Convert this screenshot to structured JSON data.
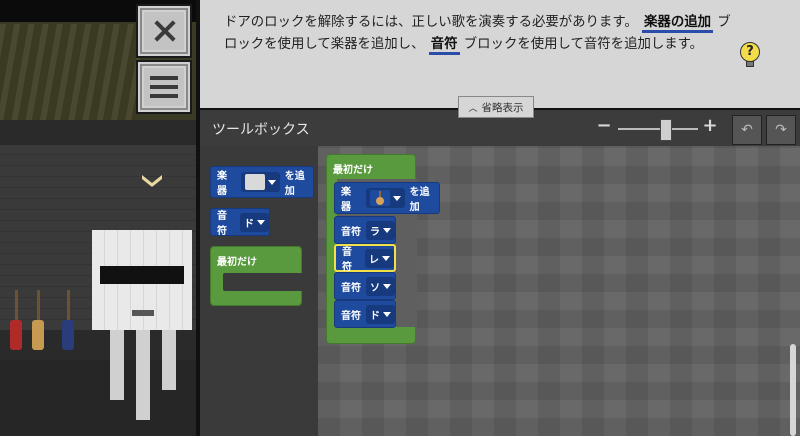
{
  "instruction": {
    "part1": "ドアのロックを解除するには、正しい歌を演奏する必要があります。",
    "kw1": "楽器の追加",
    "part2": "ブロックを使用して楽器を追加し、",
    "kw2": "音符",
    "part3": "ブロックを使用して音符を追加します。",
    "hint_symbol": "?",
    "collapse_label": "省略表示"
  },
  "toolbar": {
    "title": "ツールボックス",
    "zoom_out": "−",
    "zoom_in": "+",
    "zoom_level": 0.6,
    "undo": "↶",
    "redo": "↷"
  },
  "toolbox": {
    "add_instrument": {
      "label": "楽器",
      "action": "を追加"
    },
    "note": {
      "label": "音符",
      "value": "ド"
    },
    "start": {
      "label": "最初だけ"
    }
  },
  "program": {
    "start_label": "最初だけ",
    "add_instrument": {
      "label": "楽器",
      "action": "を追加"
    },
    "notes": [
      {
        "label": "音符",
        "value": "ラ"
      },
      {
        "label": "音符",
        "value": "レ"
      },
      {
        "label": "音符",
        "value": "ソ"
      },
      {
        "label": "音符",
        "value": "ド"
      }
    ]
  },
  "colors": {
    "block_blue": "#1e4b9e",
    "block_green": "#5a9a3e",
    "selected_outline": "#f2e04a",
    "keyword_underline": "#2a4da8"
  }
}
